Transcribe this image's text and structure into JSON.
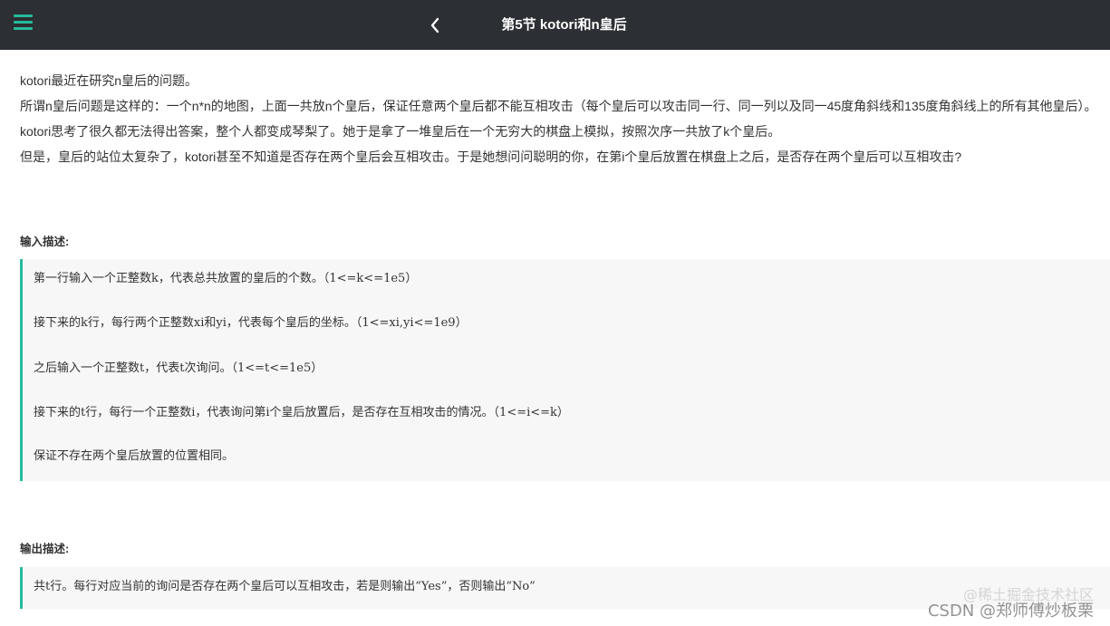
{
  "header": {
    "title": "第5节 kotori和n皇后",
    "menu_icon": "hamburger-menu-icon",
    "back_icon": "chevron-left-icon",
    "background": "#2c2f33",
    "accent": "#25bb9b"
  },
  "description": [
    "kotori最近在研究n皇后的问题。",
    "所谓n皇后问题是这样的：一个n*n的地图，上面一共放n个皇后，保证任意两个皇后都不能互相攻击（每个皇后可以攻击同一行、同一列以及同一45度角斜线和135度角斜线上的所有其他皇后）。",
    "kotori思考了很久都无法得出答案，整个人都变成琴梨了。她于是拿了一堆皇后在一个无穷大的棋盘上模拟，按照次序一共放了k个皇后。",
    "但是，皇后的站位太复杂了，kotori甚至不知道是否存在两个皇后会互相攻击。于是她想问问聪明的你，在第i个皇后放置在棋盘上之后，是否存在两个皇后可以互相攻击?"
  ],
  "input": {
    "title": "输入描述:",
    "lines": [
      "第一行输入一个正整数k，代表总共放置的皇后的个数。（1<=k<=1e5）",
      "接下来的k行，每行两个正整数xi和yi，代表每个皇后的坐标。（1<=xi,yi<=1e9）",
      "之后输入一个正整数t，代表t次询问。（1<=t<=1e5）",
      "接下来的t行，每行一个正整数i，代表询问第i个皇后放置后，是否存在互相攻击的情况。（1<=i<=k）",
      "保证不存在两个皇后放置的位置相同。"
    ]
  },
  "output": {
    "title": "输出描述:",
    "lines": [
      "共t行。每行对应当前的询问是否存在两个皇后可以互相攻击，若是则输出“Yes”，否则输出“No”"
    ]
  },
  "watermark": {
    "line1": "@稀土掘金技术社区",
    "line2": "CSDN @郑师傅炒板栗"
  }
}
